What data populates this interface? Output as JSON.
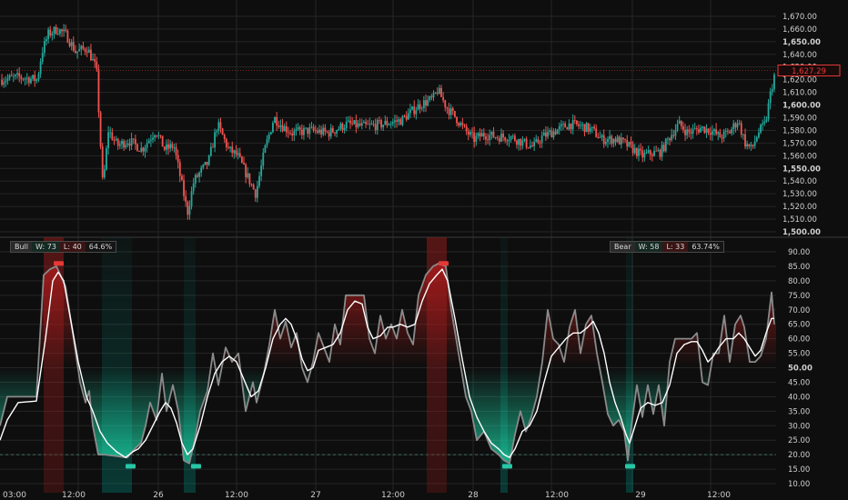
{
  "colors": {
    "background": "#0e0e0e",
    "grid": "#262626",
    "axis_text": "#cfcfcf",
    "bull_candle": "#26a69a",
    "bear_candle": "#ef5350",
    "price_tag": "#e53935",
    "oscillator_raw": "#8a8a8a",
    "oscillator_smooth": "#ffffff",
    "zone_red": "#b71c1c",
    "zone_green": "#1de9b6",
    "highlight_green": "#00897b",
    "highlight_red": "#8e1b1b"
  },
  "stats": {
    "bull": {
      "label": "Bull",
      "w": "W: 73",
      "l": "L: 40",
      "pct": "64.6%"
    },
    "bear": {
      "label": "Bear",
      "w": "W: 58",
      "l": "L: 33",
      "pct": "63.74%"
    }
  },
  "chart_data": [
    {
      "type": "candlestick",
      "title": "",
      "ylim": [
        1500,
        1675
      ],
      "y_ticks": [
        "1,670.00",
        "1,660.00",
        "1,650.00",
        "1,640.00",
        "1,630.00",
        "1,620.00",
        "1,610.00",
        "1,600.00",
        "1,590.00",
        "1,580.00",
        "1,570.00",
        "1,560.00",
        "1,550.00",
        "1,540.00",
        "1,530.00",
        "1,520.00",
        "1,510.00",
        "1,500.00"
      ],
      "bold_ticks": [
        "1,650.00",
        "1,600.00",
        "1,550.00",
        "1,500.00"
      ],
      "last_price": "1,627.29",
      "last_price_value": 1627.29,
      "bar_count": 400,
      "close_anchors": [
        [
          0,
          1620
        ],
        [
          20,
          1622
        ],
        [
          40,
          1620
        ],
        [
          45,
          1642
        ],
        [
          52,
          1656
        ],
        [
          62,
          1660
        ],
        [
          72,
          1655
        ],
        [
          82,
          1642
        ],
        [
          95,
          1645
        ],
        [
          105,
          1628
        ],
        [
          108,
          1588
        ],
        [
          112,
          1535
        ],
        [
          118,
          1580
        ],
        [
          128,
          1568
        ],
        [
          140,
          1572
        ],
        [
          155,
          1565
        ],
        [
          170,
          1580
        ],
        [
          180,
          1565
        ],
        [
          190,
          1568
        ],
        [
          198,
          1540
        ],
        [
          205,
          1515
        ],
        [
          212,
          1540
        ],
        [
          220,
          1548
        ],
        [
          228,
          1555
        ],
        [
          238,
          1585
        ],
        [
          250,
          1565
        ],
        [
          260,
          1560
        ],
        [
          270,
          1545
        ],
        [
          280,
          1530
        ],
        [
          290,
          1565
        ],
        [
          300,
          1590
        ],
        [
          310,
          1583
        ],
        [
          320,
          1578
        ],
        [
          340,
          1580
        ],
        [
          360,
          1578
        ],
        [
          380,
          1585
        ],
        [
          400,
          1583
        ],
        [
          420,
          1585
        ],
        [
          440,
          1588
        ],
        [
          460,
          1600
        ],
        [
          475,
          1605
        ],
        [
          480,
          1612
        ],
        [
          490,
          1598
        ],
        [
          500,
          1590
        ],
        [
          510,
          1580
        ],
        [
          520,
          1573
        ],
        [
          530,
          1577
        ],
        [
          545,
          1575
        ],
        [
          560,
          1575
        ],
        [
          575,
          1570
        ],
        [
          585,
          1567
        ],
        [
          595,
          1575
        ],
        [
          610,
          1580
        ],
        [
          625,
          1585
        ],
        [
          640,
          1583
        ],
        [
          650,
          1580
        ],
        [
          660,
          1573
        ],
        [
          675,
          1573
        ],
        [
          685,
          1570
        ],
        [
          695,
          1565
        ],
        [
          705,
          1560
        ],
        [
          715,
          1562
        ],
        [
          725,
          1563
        ],
        [
          735,
          1575
        ],
        [
          745,
          1585
        ],
        [
          755,
          1578
        ],
        [
          770,
          1582
        ],
        [
          780,
          1580
        ],
        [
          790,
          1575
        ],
        [
          800,
          1578
        ],
        [
          810,
          1588
        ],
        [
          818,
          1570
        ],
        [
          825,
          1565
        ],
        [
          832,
          1578
        ],
        [
          840,
          1585
        ],
        [
          846,
          1610
        ],
        [
          851,
          1627
        ]
      ]
    },
    {
      "type": "line",
      "title": "",
      "ylim": [
        10,
        90
      ],
      "y_ticks": [
        "90.00",
        "85.00",
        "80.00",
        "75.00",
        "70.00",
        "65.00",
        "60.00",
        "55.00",
        "50.00",
        "45.00",
        "40.00",
        "35.00",
        "30.00",
        "25.00",
        "20.00",
        "15.00",
        "10.00"
      ],
      "bold_ticks": [
        "50.00"
      ],
      "threshold": 20,
      "x_ticks": [
        "03:00",
        "12:00",
        "26",
        "12:00",
        "27",
        "12:00",
        "28",
        "12:00",
        "29",
        "12:00"
      ],
      "raw_series": [
        [
          0,
          30
        ],
        [
          8,
          40
        ],
        [
          40,
          40
        ],
        [
          48,
          82
        ],
        [
          55,
          84
        ],
        [
          62,
          85
        ],
        [
          72,
          78
        ],
        [
          80,
          62
        ],
        [
          88,
          45
        ],
        [
          94,
          38
        ],
        [
          98,
          42
        ],
        [
          102,
          30
        ],
        [
          108,
          20
        ],
        [
          115,
          20
        ],
        [
          140,
          19
        ],
        [
          148,
          22
        ],
        [
          155,
          24
        ],
        [
          160,
          30
        ],
        [
          165,
          38
        ],
        [
          172,
          32
        ],
        [
          178,
          48
        ],
        [
          183,
          35
        ],
        [
          190,
          44
        ],
        [
          196,
          35
        ],
        [
          202,
          18
        ],
        [
          208,
          17
        ],
        [
          214,
          25
        ],
        [
          220,
          35
        ],
        [
          228,
          42
        ],
        [
          234,
          55
        ],
        [
          240,
          44
        ],
        [
          248,
          57
        ],
        [
          255,
          52
        ],
        [
          262,
          55
        ],
        [
          270,
          35
        ],
        [
          278,
          45
        ],
        [
          282,
          38
        ],
        [
          290,
          48
        ],
        [
          296,
          58
        ],
        [
          302,
          70
        ],
        [
          308,
          60
        ],
        [
          314,
          66
        ],
        [
          320,
          57
        ],
        [
          326,
          62
        ],
        [
          332,
          50
        ],
        [
          338,
          45
        ],
        [
          344,
          52
        ],
        [
          350,
          62
        ],
        [
          356,
          57
        ],
        [
          362,
          52
        ],
        [
          368,
          65
        ],
        [
          374,
          58
        ],
        [
          380,
          75
        ],
        [
          386,
          75
        ],
        [
          394,
          75
        ],
        [
          400,
          75
        ],
        [
          406,
          60
        ],
        [
          412,
          55
        ],
        [
          418,
          68
        ],
        [
          424,
          60
        ],
        [
          430,
          65
        ],
        [
          436,
          60
        ],
        [
          442,
          70
        ],
        [
          448,
          62
        ],
        [
          454,
          58
        ],
        [
          460,
          75
        ],
        [
          468,
          82
        ],
        [
          476,
          85
        ],
        [
          482,
          86
        ],
        [
          490,
          85
        ],
        [
          496,
          70
        ],
        [
          504,
          55
        ],
        [
          512,
          40
        ],
        [
          518,
          35
        ],
        [
          524,
          25
        ],
        [
          532,
          28
        ],
        [
          540,
          22
        ],
        [
          548,
          20
        ],
        [
          554,
          18
        ],
        [
          560,
          17
        ],
        [
          566,
          27
        ],
        [
          572,
          35
        ],
        [
          578,
          28
        ],
        [
          584,
          33
        ],
        [
          590,
          40
        ],
        [
          596,
          52
        ],
        [
          602,
          70
        ],
        [
          608,
          60
        ],
        [
          614,
          58
        ],
        [
          620,
          52
        ],
        [
          626,
          64
        ],
        [
          632,
          70
        ],
        [
          638,
          55
        ],
        [
          644,
          65
        ],
        [
          650,
          68
        ],
        [
          656,
          55
        ],
        [
          662,
          45
        ],
        [
          668,
          34
        ],
        [
          674,
          30
        ],
        [
          680,
          32
        ],
        [
          686,
          28
        ],
        [
          690,
          18
        ],
        [
          694,
          30
        ],
        [
          700,
          44
        ],
        [
          706,
          33
        ],
        [
          712,
          44
        ],
        [
          718,
          34
        ],
        [
          724,
          44
        ],
        [
          730,
          30
        ],
        [
          736,
          52
        ],
        [
          742,
          60
        ],
        [
          748,
          60
        ],
        [
          754,
          60
        ],
        [
          760,
          60
        ],
        [
          766,
          62
        ],
        [
          772,
          45
        ],
        [
          778,
          44
        ],
        [
          784,
          55
        ],
        [
          790,
          55
        ],
        [
          796,
          68
        ],
        [
          802,
          52
        ],
        [
          808,
          65
        ],
        [
          814,
          68
        ],
        [
          818,
          64
        ],
        [
          824,
          52
        ],
        [
          830,
          52
        ],
        [
          836,
          54
        ],
        [
          842,
          60
        ],
        [
          848,
          76
        ],
        [
          851,
          65
        ]
      ],
      "smooth_series": [
        [
          0,
          25
        ],
        [
          8,
          32
        ],
        [
          20,
          38
        ],
        [
          40,
          38.5
        ],
        [
          50,
          60
        ],
        [
          58,
          80
        ],
        [
          64,
          83
        ],
        [
          70,
          80
        ],
        [
          78,
          66
        ],
        [
          86,
          52
        ],
        [
          95,
          40
        ],
        [
          102,
          35
        ],
        [
          110,
          28
        ],
        [
          118,
          24
        ],
        [
          128,
          21
        ],
        [
          138,
          19
        ],
        [
          146,
          21
        ],
        [
          152,
          22
        ],
        [
          160,
          25
        ],
        [
          168,
          30
        ],
        [
          176,
          35
        ],
        [
          182,
          38
        ],
        [
          188,
          36
        ],
        [
          194,
          31
        ],
        [
          200,
          24
        ],
        [
          206,
          20
        ],
        [
          212,
          22
        ],
        [
          220,
          30
        ],
        [
          228,
          40
        ],
        [
          236,
          48
        ],
        [
          244,
          52
        ],
        [
          252,
          54
        ],
        [
          260,
          52
        ],
        [
          268,
          46
        ],
        [
          276,
          40
        ],
        [
          284,
          42
        ],
        [
          292,
          50
        ],
        [
          300,
          60
        ],
        [
          308,
          65
        ],
        [
          314,
          67
        ],
        [
          320,
          65
        ],
        [
          326,
          60
        ],
        [
          332,
          53
        ],
        [
          338,
          49
        ],
        [
          344,
          50
        ],
        [
          350,
          56
        ],
        [
          358,
          57
        ],
        [
          366,
          58
        ],
        [
          374,
          62
        ],
        [
          382,
          70
        ],
        [
          390,
          73
        ],
        [
          398,
          72
        ],
        [
          404,
          64
        ],
        [
          410,
          60
        ],
        [
          418,
          61
        ],
        [
          426,
          64
        ],
        [
          432,
          64
        ],
        [
          440,
          65
        ],
        [
          448,
          64
        ],
        [
          456,
          65
        ],
        [
          464,
          73
        ],
        [
          472,
          79
        ],
        [
          480,
          82
        ],
        [
          486,
          84
        ],
        [
          492,
          80
        ],
        [
          500,
          67
        ],
        [
          508,
          53
        ],
        [
          516,
          40
        ],
        [
          524,
          33
        ],
        [
          532,
          28
        ],
        [
          540,
          24
        ],
        [
          548,
          22
        ],
        [
          554,
          20
        ],
        [
          560,
          19
        ],
        [
          566,
          22
        ],
        [
          574,
          28
        ],
        [
          582,
          30
        ],
        [
          590,
          35
        ],
        [
          598,
          45
        ],
        [
          606,
          54
        ],
        [
          614,
          57
        ],
        [
          622,
          60
        ],
        [
          630,
          62
        ],
        [
          638,
          62
        ],
        [
          646,
          64
        ],
        [
          652,
          66
        ],
        [
          658,
          62
        ],
        [
          664,
          55
        ],
        [
          670,
          45
        ],
        [
          676,
          38
        ],
        [
          682,
          33
        ],
        [
          688,
          27
        ],
        [
          692,
          24
        ],
        [
          696,
          28
        ],
        [
          704,
          36
        ],
        [
          712,
          38
        ],
        [
          720,
          37
        ],
        [
          728,
          38
        ],
        [
          736,
          44
        ],
        [
          744,
          55
        ],
        [
          752,
          58
        ],
        [
          760,
          59
        ],
        [
          766,
          59
        ],
        [
          772,
          56
        ],
        [
          778,
          52
        ],
        [
          784,
          54
        ],
        [
          790,
          57
        ],
        [
          798,
          60
        ],
        [
          806,
          60
        ],
        [
          812,
          62
        ],
        [
          818,
          60
        ],
        [
          824,
          57
        ],
        [
          830,
          54
        ],
        [
          836,
          56
        ],
        [
          842,
          62
        ],
        [
          848,
          67
        ],
        [
          851,
          67
        ]
      ],
      "markers": [
        {
          "x": 64,
          "value": 86,
          "color": "red"
        },
        {
          "x": 143,
          "value": 16,
          "color": "green"
        },
        {
          "x": 215,
          "value": 16,
          "color": "green"
        },
        {
          "x": 487,
          "value": 86,
          "color": "red"
        },
        {
          "x": 557,
          "value": 16,
          "color": "green"
        },
        {
          "x": 692,
          "value": 16,
          "color": "green"
        }
      ],
      "highlights": [
        {
          "from": 48,
          "to": 70,
          "color": "red"
        },
        {
          "from": 112,
          "to": 145,
          "color": "green"
        },
        {
          "from": 202,
          "to": 215,
          "color": "green"
        },
        {
          "from": 469,
          "to": 491,
          "color": "red"
        },
        {
          "from": 550,
          "to": 558,
          "color": "green"
        },
        {
          "from": 688,
          "to": 696,
          "color": "green"
        }
      ]
    }
  ]
}
